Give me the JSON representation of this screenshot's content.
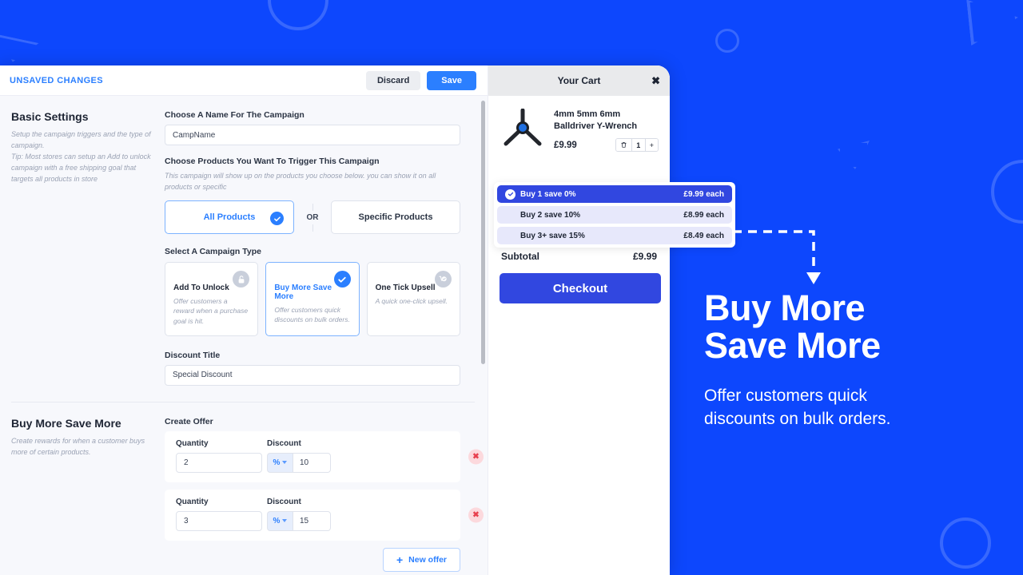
{
  "theme": {
    "background_blue": "#0d47fd",
    "accent_blue": "#2b7fff",
    "cart_blue": "#3147e0",
    "danger_pink": "#fcd9dd"
  },
  "topbar": {
    "unsaved_label": "UNSAVED CHANGES",
    "discard_label": "Discard",
    "save_label": "Save"
  },
  "basic_settings": {
    "title": "Basic Settings",
    "description": "Setup the campaign triggers and the type of campaign.\nTip: Most stores can setup an Add to unlock campaign with a free shipping goal that targets all products in store",
    "name_label": "Choose A Name For The Campaign",
    "name_value": "CampName",
    "products_label": "Choose Products You Want To Trigger This Campaign",
    "products_sub": "This campaign will show up on the products you choose below. you can show it on all products or specific",
    "choice_all": "All Products",
    "choice_or": "OR",
    "choice_specific": "Specific Products",
    "type_label": "Select A Campaign Type",
    "types": [
      {
        "name": "Add To Unlock",
        "desc": "Offer customers a reward when a purchase goal is hit.",
        "icon": "unlock-icon",
        "selected": false
      },
      {
        "name": "Buy More Save More",
        "desc": "Offer customers quick discounts on bulk orders.",
        "icon": "check-icon",
        "selected": true
      },
      {
        "name": "One Tick Upsell",
        "desc": "A quick one-click upsell.",
        "icon": "cart-check-icon",
        "selected": false
      }
    ],
    "discount_title_label": "Discount Title",
    "discount_title_value": "Special Discount"
  },
  "buy_more": {
    "title": "Buy More Save More",
    "description": "Create rewards for when a customer buys more of certain products.",
    "create_offer_label": "Create Offer",
    "qty_label": "Quantity",
    "discount_label": "Discount",
    "unit_symbol": "%",
    "offers": [
      {
        "quantity": "2",
        "discount": "10"
      },
      {
        "quantity": "3",
        "discount": "15"
      }
    ],
    "new_offer_label": "New offer",
    "plus_glyph": "+",
    "delete_glyph": "✖"
  },
  "cart": {
    "title": "Your Cart",
    "close_glyph": "✖",
    "item": {
      "name": "4mm 5mm 6mm Balldriver Y-Wrench",
      "price": "£9.99",
      "quantity": "1",
      "trash_glyph": "🗑",
      "plus_glyph": "+"
    },
    "tiers": [
      {
        "label": "Buy 1 save 0%",
        "price": "£9.99 each",
        "active": true
      },
      {
        "label": "Buy 2 save 10%",
        "price": "£8.99 each",
        "active": false
      },
      {
        "label": "Buy 3+ save 15%",
        "price": "£8.49 each",
        "active": false
      }
    ],
    "subtotal_label": "Subtotal",
    "subtotal_value": "£9.99",
    "checkout_label": "Checkout"
  },
  "promo": {
    "title_line1": "Buy More",
    "title_line2": "Save More",
    "subtitle_line1": "Offer customers quick",
    "subtitle_line2": "discounts on bulk orders."
  }
}
